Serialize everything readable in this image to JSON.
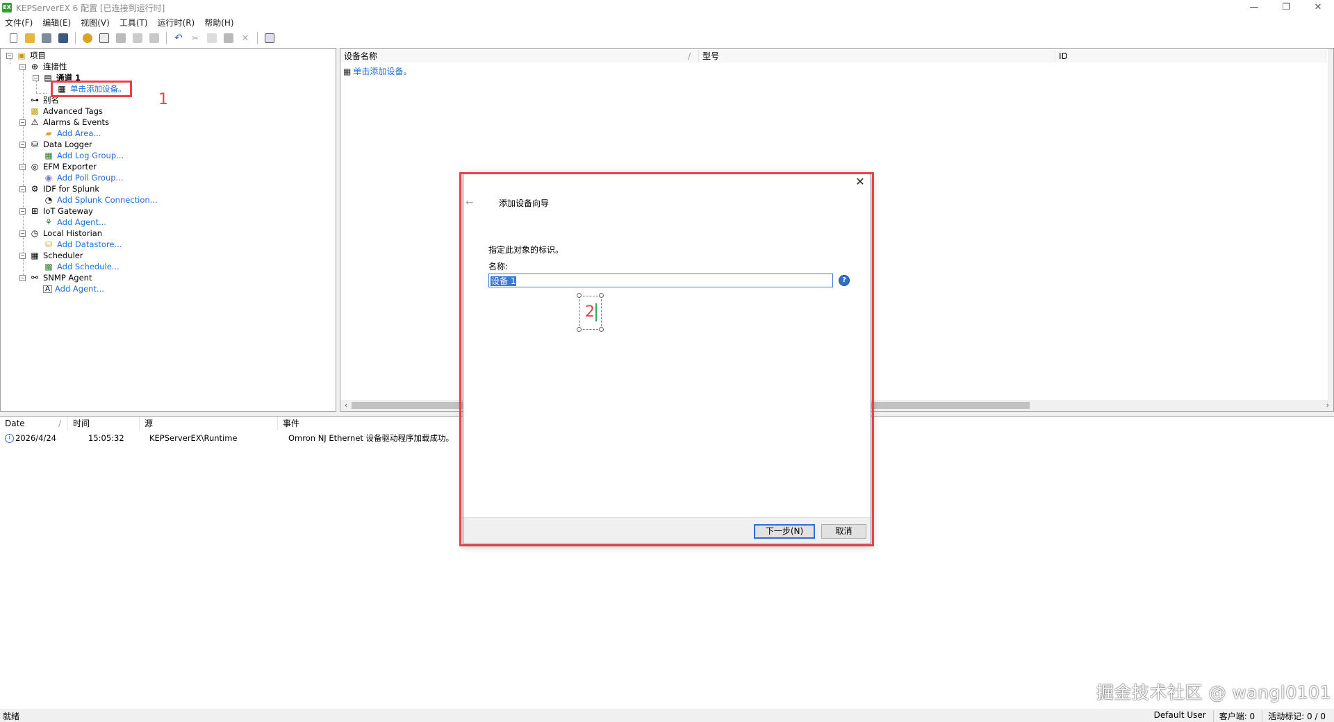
{
  "window": {
    "title": "KEPServerEX 6 配置 [已连接到运行时]",
    "app_icon": "EX",
    "controls": [
      "—",
      "❐",
      "✕"
    ]
  },
  "menu": [
    "文件(F)",
    "编辑(E)",
    "视图(V)",
    "工具(T)",
    "运行时(R)",
    "帮助(H)"
  ],
  "tree": {
    "project": "项目",
    "connectivity": "连接性",
    "channel": "通道 1",
    "add_device": "单击添加设备。",
    "aliases": "别名",
    "items": [
      {
        "label": "Advanced Tags",
        "child": null
      },
      {
        "label": "Alarms & Events",
        "child": "Add Area..."
      },
      {
        "label": "Data Logger",
        "child": "Add Log Group..."
      },
      {
        "label": "EFM Exporter",
        "child": "Add Poll Group..."
      },
      {
        "label": "IDF for Splunk",
        "child": "Add Splunk Connection..."
      },
      {
        "label": "IoT Gateway",
        "child": "Add Agent..."
      },
      {
        "label": "Local Historian",
        "child": "Add Datastore..."
      },
      {
        "label": "Scheduler",
        "child": "Add Schedule..."
      },
      {
        "label": "SNMP Agent",
        "child": "Add Agent..."
      }
    ]
  },
  "device_list": {
    "columns": [
      "设备名称",
      "型号",
      "ID"
    ],
    "sort_indicator": "/",
    "placeholder_row": "单击添加设备。"
  },
  "events": {
    "columns": [
      "Date",
      "时间",
      "源",
      "事件"
    ],
    "rows": [
      {
        "date": "2026/4/24",
        "time": "15:05:32",
        "source": "KEPServerEX\\Runtime",
        "event": "Omron NJ Ethernet 设备驱动程序加载成功。"
      }
    ]
  },
  "dialog": {
    "title": "添加设备向导",
    "prompt": "指定此对象的标识。",
    "name_label": "名称:",
    "name_value": "设备 1",
    "next_button": "下一步(N)",
    "cancel_button": "取消"
  },
  "annotations": {
    "step1": "1",
    "step2": "2",
    "color": "#e8414a"
  },
  "status": {
    "left": "就绪",
    "user": "Default User",
    "clients": "客户端: 0",
    "active_tags": "活动标记: 0 / 0"
  },
  "watermark": "掘金技术社区 @ wangl0101",
  "colors": {
    "link": "#1e6fd9",
    "accent": "#2c6dd6",
    "highlight_red": "#e8414a"
  }
}
